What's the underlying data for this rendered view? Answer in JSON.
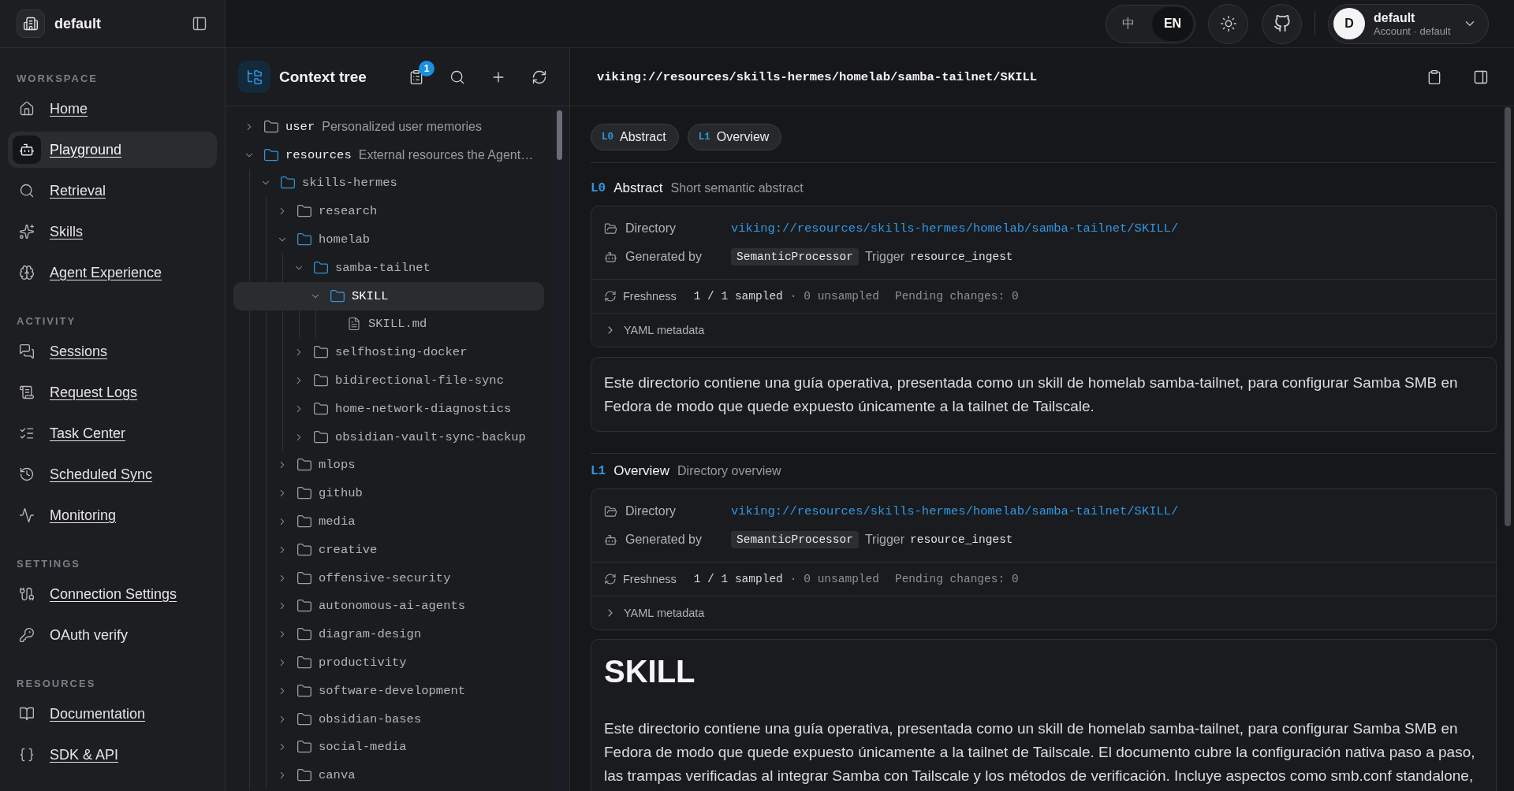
{
  "sidebar": {
    "workspace": "default",
    "sections": [
      {
        "title": "WORKSPACE",
        "items": [
          {
            "label": "Home",
            "selected": false,
            "underlined": true
          },
          {
            "label": "Playground",
            "selected": true,
            "underlined": true
          },
          {
            "label": "Retrieval",
            "selected": false,
            "underlined": true
          },
          {
            "label": "Skills",
            "selected": false,
            "underlined": true
          },
          {
            "label": "Agent Experience",
            "selected": false,
            "underlined": true
          }
        ]
      },
      {
        "title": "ACTIVITY",
        "items": [
          {
            "label": "Sessions",
            "selected": false,
            "underlined": true
          },
          {
            "label": "Request Logs",
            "selected": false,
            "underlined": true
          },
          {
            "label": "Task Center",
            "selected": false,
            "underlined": true
          },
          {
            "label": "Scheduled Sync",
            "selected": false,
            "underlined": true
          },
          {
            "label": "Monitoring",
            "selected": false,
            "underlined": true
          }
        ]
      },
      {
        "title": "SETTINGS",
        "items": [
          {
            "label": "Connection Settings",
            "selected": false,
            "underlined": true
          },
          {
            "label": "OAuth verify",
            "selected": false,
            "underlined": false
          }
        ]
      },
      {
        "title": "RESOURCES",
        "items": [
          {
            "label": "Documentation",
            "selected": false,
            "underlined": true
          },
          {
            "label": "SDK & API",
            "selected": false,
            "underlined": true
          }
        ]
      }
    ]
  },
  "topbar": {
    "languages": [
      {
        "label": "中",
        "selected": false
      },
      {
        "label": "EN",
        "selected": true
      }
    ],
    "account": {
      "initial": "D",
      "name": "default",
      "subtitle": "Account · default"
    }
  },
  "context_tree": {
    "title": "Context tree",
    "badge": "1",
    "nodes": [
      {
        "kind": "folder",
        "name": "user",
        "description": "Personalized user memories",
        "expanded": false,
        "selected": false
      },
      {
        "kind": "folder",
        "name": "resources",
        "description": "External resources the Agent…",
        "expanded": true,
        "selected": false,
        "children": [
          {
            "kind": "folder",
            "name": "skills-hermes",
            "expanded": true,
            "selected": false,
            "children": [
              {
                "kind": "folder",
                "name": "research",
                "expanded": false,
                "selected": false
              },
              {
                "kind": "folder",
                "name": "homelab",
                "expanded": true,
                "selected": false,
                "children": [
                  {
                    "kind": "folder",
                    "name": "samba-tailnet",
                    "expanded": true,
                    "selected": false,
                    "children": [
                      {
                        "kind": "folder",
                        "name": "SKILL",
                        "expanded": true,
                        "selected": true,
                        "children": [
                          {
                            "kind": "file",
                            "name": "SKILL.md",
                            "selected": false
                          }
                        ]
                      }
                    ]
                  },
                  {
                    "kind": "folder",
                    "name": "selfhosting-docker",
                    "expanded": false,
                    "selected": false
                  },
                  {
                    "kind": "folder",
                    "name": "bidirectional-file-sync",
                    "expanded": false,
                    "selected": false
                  },
                  {
                    "kind": "folder",
                    "name": "home-network-diagnostics",
                    "expanded": false,
                    "selected": false
                  },
                  {
                    "kind": "folder",
                    "name": "obsidian-vault-sync-backup",
                    "expanded": false,
                    "selected": false
                  }
                ]
              },
              {
                "kind": "folder",
                "name": "mlops",
                "expanded": false,
                "selected": false
              },
              {
                "kind": "folder",
                "name": "github",
                "expanded": false,
                "selected": false
              },
              {
                "kind": "folder",
                "name": "media",
                "expanded": false,
                "selected": false
              },
              {
                "kind": "folder",
                "name": "creative",
                "expanded": false,
                "selected": false
              },
              {
                "kind": "folder",
                "name": "offensive-security",
                "expanded": false,
                "selected": false
              },
              {
                "kind": "folder",
                "name": "autonomous-ai-agents",
                "expanded": false,
                "selected": false
              },
              {
                "kind": "folder",
                "name": "diagram-design",
                "expanded": false,
                "selected": false
              },
              {
                "kind": "folder",
                "name": "productivity",
                "expanded": false,
                "selected": false
              },
              {
                "kind": "folder",
                "name": "software-development",
                "expanded": false,
                "selected": false
              },
              {
                "kind": "folder",
                "name": "obsidian-bases",
                "expanded": false,
                "selected": false
              },
              {
                "kind": "folder",
                "name": "social-media",
                "expanded": false,
                "selected": false
              },
              {
                "kind": "folder",
                "name": "canva",
                "expanded": false,
                "selected": false
              }
            ]
          }
        ]
      }
    ]
  },
  "detail": {
    "path": "viking://resources/skills-hermes/homelab/samba-tailnet/SKILL",
    "jump_links": [
      {
        "level": "L0",
        "label": "Abstract"
      },
      {
        "level": "L1",
        "label": "Overview"
      }
    ],
    "sections": [
      {
        "level": "L0",
        "title": "Abstract",
        "subtitle": "Short semantic abstract",
        "meta": {
          "directory_label": "Directory",
          "directory": "viking://resources/skills-hermes/homelab/samba-tailnet/SKILL/",
          "generator_label": "Generated by",
          "generator": "SemanticProcessor",
          "trigger_label": "Trigger",
          "trigger": "resource_ingest",
          "freshness_label": "Freshness",
          "sampled": "1 / 1 sampled",
          "unsampled": "· 0 unsampled",
          "pending": "Pending changes: 0",
          "yaml": {
            "label": "YAML metadata",
            "expanded": false
          }
        },
        "body": {
          "kind": "text",
          "text": "Este directorio contiene una guía operativa, presentada como un skill de homelab samba-tailnet, para configurar Samba SMB en Fedora de modo que quede expuesto únicamente a la tailnet de Tailscale."
        }
      },
      {
        "level": "L1",
        "title": "Overview",
        "subtitle": "Directory overview",
        "meta": {
          "directory_label": "Directory",
          "directory": "viking://resources/skills-hermes/homelab/samba-tailnet/SKILL/",
          "generator_label": "Generated by",
          "generator": "SemanticProcessor",
          "trigger_label": "Trigger",
          "trigger": "resource_ingest",
          "freshness_label": "Freshness",
          "sampled": "1 / 1 sampled",
          "unsampled": "· 0 unsampled",
          "pending": "Pending changes: 0",
          "yaml": {
            "label": "YAML metadata",
            "expanded": false
          }
        },
        "body": {
          "kind": "markdown",
          "heading": "SKILL",
          "text": "Este directorio contiene una guía operativa, presentada como un skill de homelab samba-tailnet, para configurar Samba SMB en Fedora de modo que quede expuesto únicamente a la tailnet de Tailscale. El documento cubre la configuración nativa paso a paso, las trampas verificadas al integrar Samba con Tailscale y los métodos de verificación. Incluye aspectos como smb.conf standalone,"
        }
      }
    ]
  }
}
